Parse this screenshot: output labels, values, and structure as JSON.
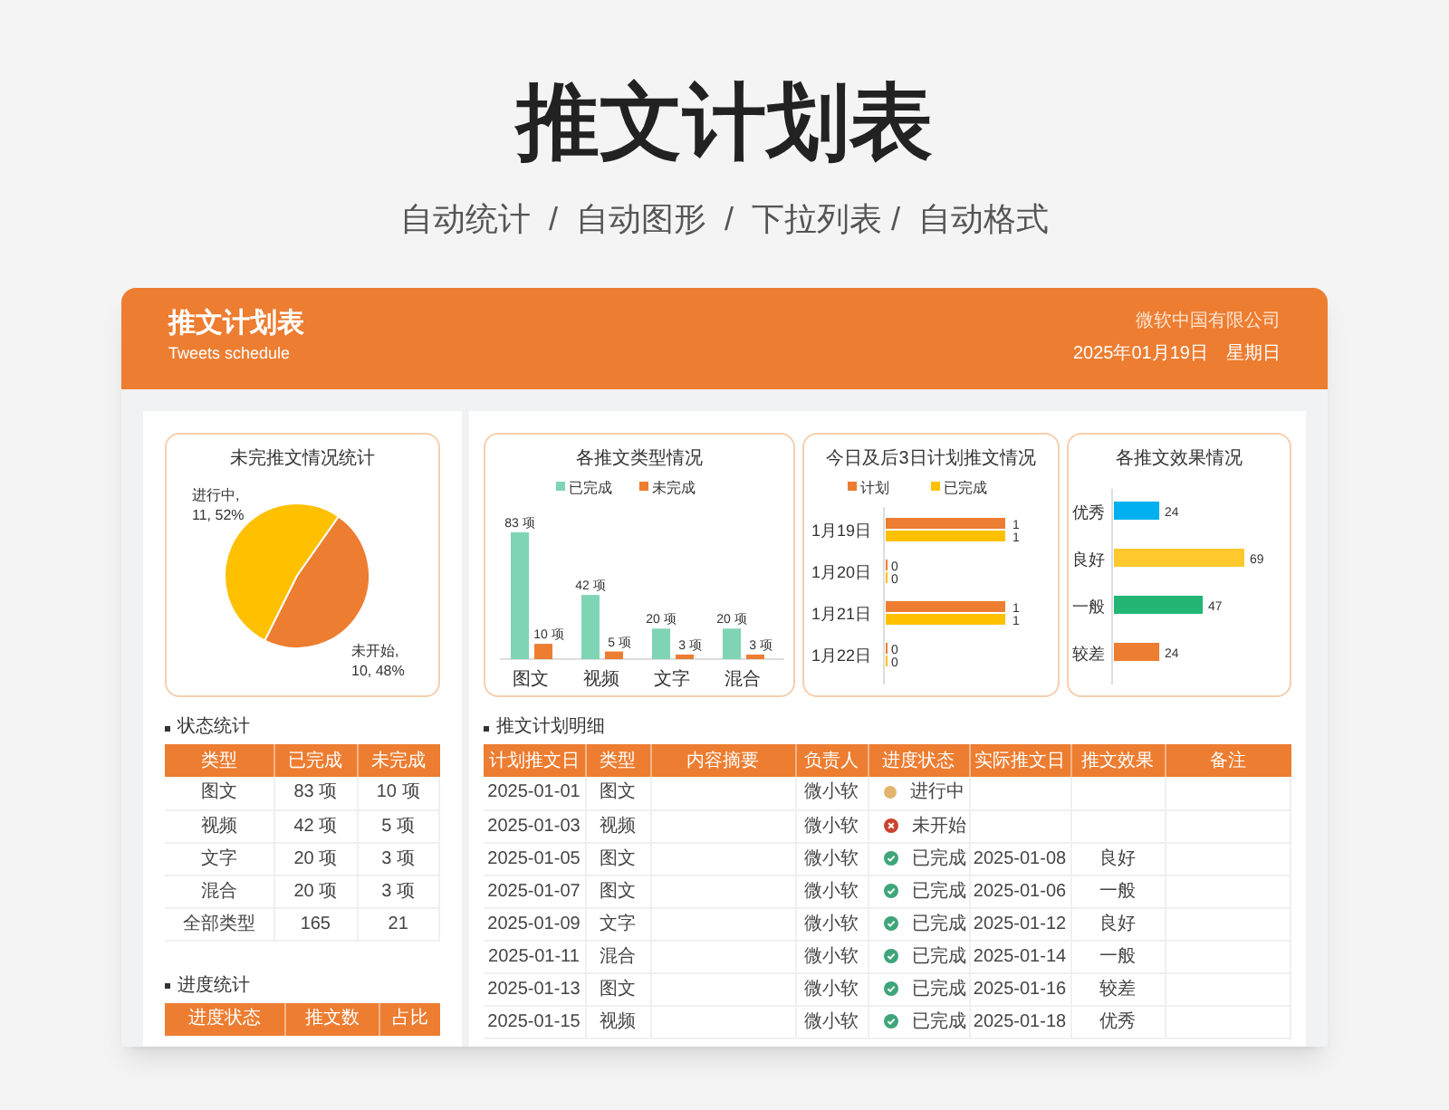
{
  "page": {
    "title": "推文计划表",
    "subtitle": "自动统计  /  自动图形  /  下拉列表 /  自动格式"
  },
  "header": {
    "title": "推文计划表",
    "subtitle": "Tweets schedule",
    "company": "微软中国有限公司",
    "date": "2025年01月19日",
    "weekday": "星期日"
  },
  "charts": [
    {
      "title": "未完推文情况统计",
      "label_separator": ",",
      "chart_data": {
        "type": "pie",
        "categories": [
          "进行中",
          "未开始"
        ],
        "values": [
          11,
          10
        ],
        "colors": [
          "#ffc000",
          "#ed7d31"
        ],
        "value_labels": [
          "11, 52%",
          "10, 48%"
        ]
      }
    },
    {
      "title": "各推文类型情况",
      "chart_data": {
        "type": "bar",
        "legend": "top",
        "categories": [
          "图文",
          "视频",
          "文字",
          "混合"
        ],
        "series": [
          {
            "name": "已完成",
            "color": "#7fd4b4",
            "values": [
              83,
              42,
              20,
              20
            ],
            "value_labels": [
              "83 项",
              "42 项",
              "20 项",
              "20 项"
            ]
          },
          {
            "name": "未完成",
            "color": "#ed7d31",
            "values": [
              10,
              5,
              3,
              3
            ],
            "value_labels": [
              "10 项",
              "5 项",
              "3 项",
              "3 项"
            ]
          }
        ]
      }
    },
    {
      "title": "今日及后3日计划推文情况",
      "chart_data": {
        "type": "bar",
        "orientation": "horizontal",
        "legend": "top",
        "categories": [
          "1月19日",
          "1月20日",
          "1月21日",
          "1月22日"
        ],
        "series": [
          {
            "name": "计划",
            "color": "#ed7d31",
            "values": [
              1,
              0,
              1,
              0
            ],
            "value_labels": [
              "1",
              "0",
              "1",
              "0"
            ]
          },
          {
            "name": "已完成",
            "color": "#ffc000",
            "values": [
              1,
              0,
              1,
              0
            ],
            "value_labels": [
              "1",
              "0",
              "1",
              "0"
            ]
          }
        ]
      }
    },
    {
      "title": "各推文效果情况",
      "chart_data": {
        "type": "bar",
        "orientation": "horizontal",
        "categories": [
          "优秀",
          "良好",
          "一般",
          "较差"
        ],
        "data_labels": true,
        "series": [
          {
            "values": [
              24,
              69,
              47,
              24
            ],
            "colors": [
              "#00b0f0",
              "#ffc82c",
              "#22b573",
              "#ed7d31"
            ]
          }
        ]
      }
    }
  ],
  "status_section": {
    "label": "状态统计",
    "columns": [
      "类型",
      "已完成",
      "未完成"
    ],
    "rows": [
      [
        "图文",
        "83 项",
        "10 项"
      ],
      [
        "视频",
        "42 项",
        "5 项"
      ],
      [
        "文字",
        "20 项",
        "3 项"
      ],
      [
        "混合",
        "20 项",
        "3 项"
      ],
      [
        "全部类型",
        "165",
        "21"
      ]
    ]
  },
  "progress_section": {
    "label": "进度统计",
    "columns": [
      "进度状态",
      "推文数",
      "占比"
    ]
  },
  "detail_section": {
    "label": "推文计划明细",
    "columns": [
      "计划推文日",
      "类型",
      "内容摘要",
      "负责人",
      "进度状态",
      "实际推文日",
      "推文效果",
      "备注"
    ],
    "rows": [
      {
        "date": "2025-01-01",
        "type": "图文",
        "owner": "微小软",
        "kind": "in_progress",
        "status": "进行中"
      },
      {
        "date": "2025-01-03",
        "type": "视频",
        "owner": "微小软",
        "kind": "not_started",
        "status": "未开始"
      },
      {
        "date": "2025-01-05",
        "type": "图文",
        "owner": "微小软",
        "kind": "done",
        "status": "已完成",
        "actual": "2025-01-08",
        "effect": "良好"
      },
      {
        "date": "2025-01-07",
        "type": "图文",
        "owner": "微小软",
        "kind": "done",
        "status": "已完成",
        "actual": "2025-01-06",
        "effect": "一般"
      },
      {
        "date": "2025-01-09",
        "type": "文字",
        "owner": "微小软",
        "kind": "done",
        "status": "已完成",
        "actual": "2025-01-12",
        "effect": "良好"
      },
      {
        "date": "2025-01-11",
        "type": "混合",
        "owner": "微小软",
        "kind": "done",
        "status": "已完成",
        "actual": "2025-01-14",
        "effect": "一般"
      },
      {
        "date": "2025-01-13",
        "type": "图文",
        "owner": "微小软",
        "kind": "done",
        "status": "已完成",
        "actual": "2025-01-16",
        "effect": "较差"
      },
      {
        "date": "2025-01-15",
        "type": "视频",
        "owner": "微小软",
        "kind": "done",
        "status": "已完成",
        "actual": "2025-01-18",
        "effect": "优秀"
      }
    ]
  }
}
